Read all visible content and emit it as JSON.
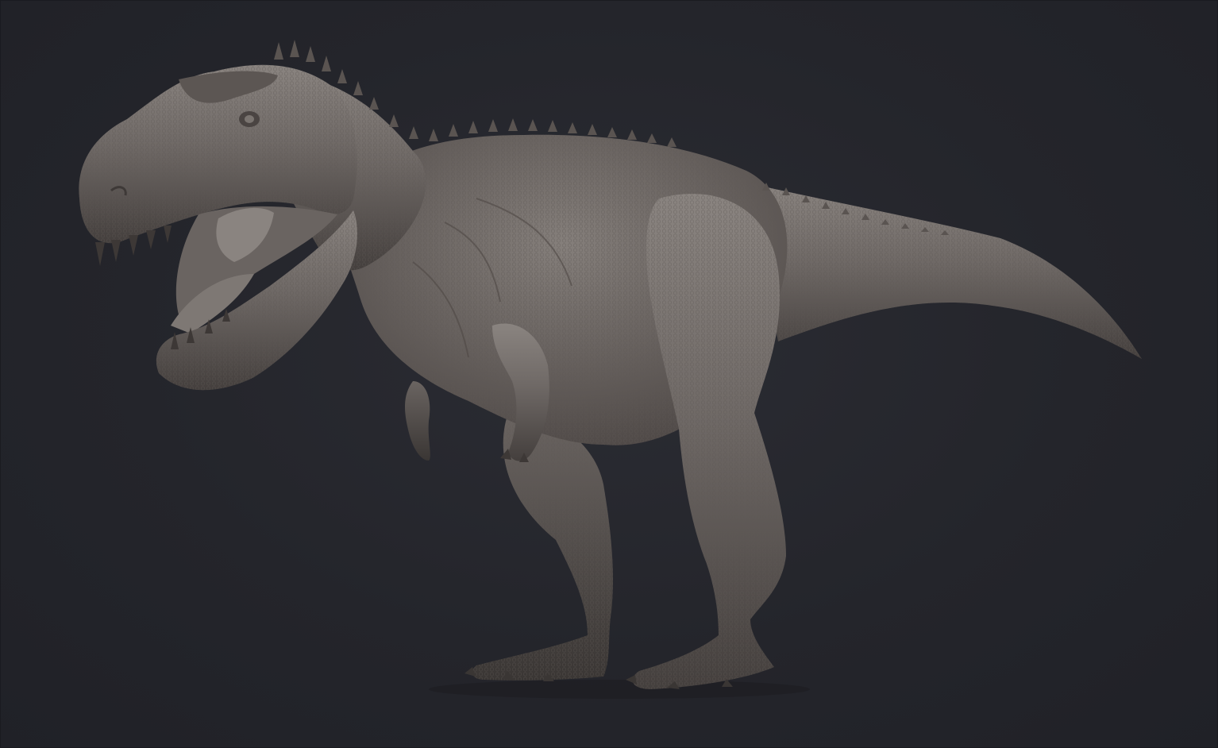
{
  "scene": {
    "subject": "dinosaur-sculpt",
    "background_color": "#24252b",
    "clay_color": "#6f6966",
    "clay_highlight": "#8d8783",
    "clay_shadow": "#3f3a38"
  }
}
